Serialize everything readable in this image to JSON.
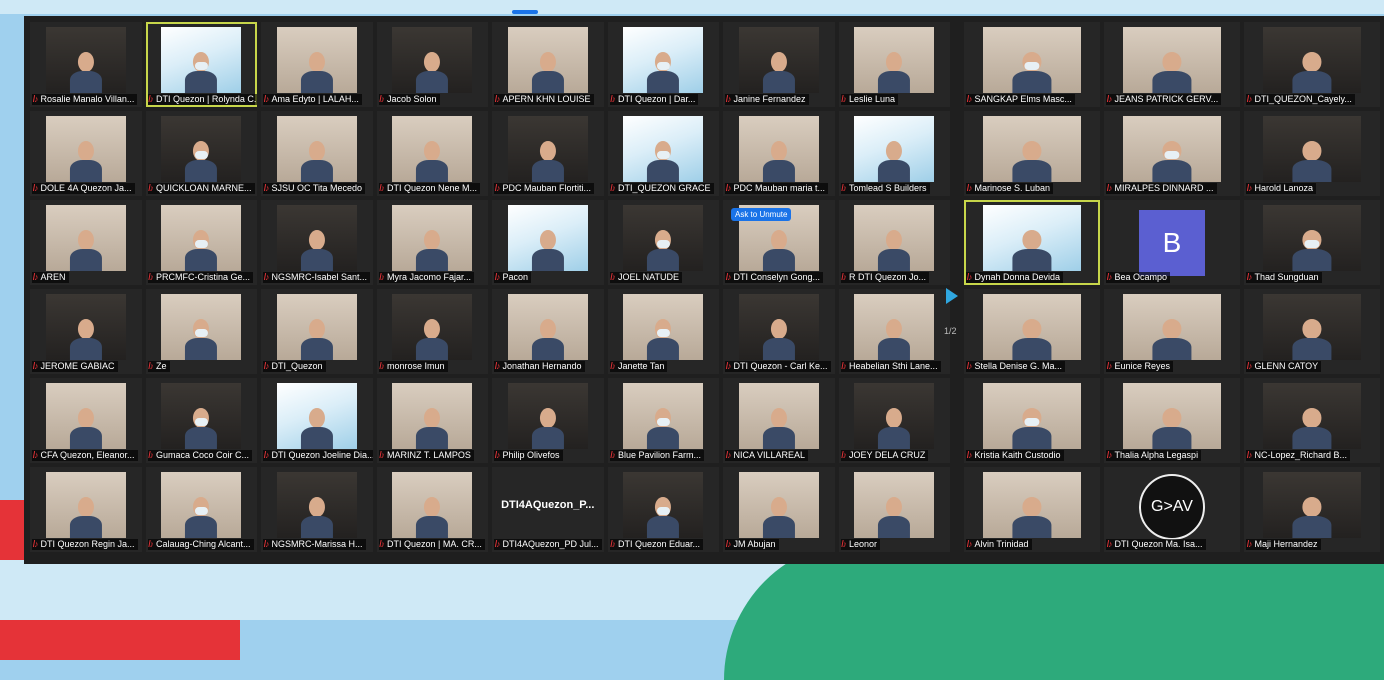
{
  "meeting": {
    "left_tiles": [
      {
        "name": "Rosalie Manalo Villan...",
        "kind": "photo"
      },
      {
        "name": "DTI Quezon | Rolynda C...",
        "kind": "slide",
        "active": true
      },
      {
        "name": "Ama Edyto | LALAH...",
        "kind": "photo"
      },
      {
        "name": "Jacob Solon",
        "kind": "photo"
      },
      {
        "name": "APERN KHN LOUISE",
        "kind": "photo"
      },
      {
        "name": "DTI Quezon | Dar...",
        "kind": "slide"
      },
      {
        "name": "Janine Fernandez",
        "kind": "photo"
      },
      {
        "name": "Leslie Luna",
        "kind": "photo"
      },
      {
        "name": "DOLE 4A Quezon Ja...",
        "kind": "photo"
      },
      {
        "name": "QUICKLOAN MARNE...",
        "kind": "photo"
      },
      {
        "name": "SJSU OC Tita Mecedo",
        "kind": "photo"
      },
      {
        "name": "DTI Quezon Nene M...",
        "kind": "photo"
      },
      {
        "name": "PDC Mauban Flortiti...",
        "kind": "photo"
      },
      {
        "name": "DTI_QUEZON GRACE",
        "kind": "slide"
      },
      {
        "name": "PDC Mauban maria t...",
        "kind": "photo"
      },
      {
        "name": "Tomlead S Builders",
        "kind": "slide"
      },
      {
        "name": "AREN",
        "kind": "photo"
      },
      {
        "name": "PRCMFC-Cristina Ge...",
        "kind": "photo"
      },
      {
        "name": "NGSMRC-Isabel Sant...",
        "kind": "photo"
      },
      {
        "name": "Myra Jacomo Fajar...",
        "kind": "photo"
      },
      {
        "name": "Pacon",
        "kind": "slide"
      },
      {
        "name": "JOEL NATUDE",
        "kind": "photo"
      },
      {
        "name": "DTI Conselyn Gong...",
        "kind": "photo",
        "pill": "Ask to Unmute"
      },
      {
        "name": "R DTI Quezon Jo...",
        "kind": "photo"
      },
      {
        "name": "JEROME GABIAC",
        "kind": "photo"
      },
      {
        "name": "Ze",
        "kind": "photo"
      },
      {
        "name": "DTI_Quezon",
        "kind": "photo"
      },
      {
        "name": "monrose Imun",
        "kind": "photo"
      },
      {
        "name": "Jonathan Hernando",
        "kind": "photo"
      },
      {
        "name": "Janette Tan",
        "kind": "photo"
      },
      {
        "name": "DTI Quezon - Carl Ke...",
        "kind": "photo"
      },
      {
        "name": "Heabelian Sthi Lane...",
        "kind": "photo"
      },
      {
        "name": "CFA Quezon, Eleanor...",
        "kind": "photo"
      },
      {
        "name": "Gumaca Coco Coir C...",
        "kind": "photo"
      },
      {
        "name": "DTI Quezon Joeline Dia...",
        "kind": "slide"
      },
      {
        "name": "MARINZ T. LAMPOS",
        "kind": "photo"
      },
      {
        "name": "Philip Olivefos",
        "kind": "photo"
      },
      {
        "name": "Blue Pavilion Farm...",
        "kind": "photo"
      },
      {
        "name": "NICA VILLAREAL",
        "kind": "photo"
      },
      {
        "name": "JOEY DELA CRUZ",
        "kind": "photo"
      },
      {
        "name": "DTI Quezon Regin Ja...",
        "kind": "photo"
      },
      {
        "name": "Calauag-Ching Alcant...",
        "kind": "photo"
      },
      {
        "name": "NGSMRC-Marissa H...",
        "kind": "photo"
      },
      {
        "name": "DTI Quezon | MA. CR...",
        "kind": "photo"
      },
      {
        "name": "DTI4AQuezon_PD Jul...",
        "kind": "label",
        "label": "DTI4AQuezon_P..."
      },
      {
        "name": "DTI Quezon Eduar...",
        "kind": "photo"
      },
      {
        "name": "JM Abujan",
        "kind": "photo"
      },
      {
        "name": "Leonor",
        "kind": "photo"
      }
    ],
    "right_tiles": [
      {
        "name": "SANGKAP Elms Masc...",
        "kind": "photo"
      },
      {
        "name": "JEANS PATRICK GERV...",
        "kind": "photo"
      },
      {
        "name": "DTI_QUEZON_Cayely...",
        "kind": "photo"
      },
      {
        "name": "Marinose S. Luban",
        "kind": "photo"
      },
      {
        "name": "MIRALPES DINNARD ...",
        "kind": "photo"
      },
      {
        "name": "Harold Lanoza",
        "kind": "photo"
      },
      {
        "name": "Dynah Donna Devida",
        "kind": "slide",
        "active": true
      },
      {
        "name": "Bea Ocampo",
        "kind": "avatar",
        "avatar": "B"
      },
      {
        "name": "Thad Sungduan",
        "kind": "photo"
      },
      {
        "name": "Stella Denise G. Ma...",
        "kind": "photo"
      },
      {
        "name": "Eunice Reyes",
        "kind": "photo"
      },
      {
        "name": "GLENN CATOY",
        "kind": "photo"
      },
      {
        "name": "Kristia Kaith Custodio",
        "kind": "photo"
      },
      {
        "name": "Thalia Alpha Legaspi",
        "kind": "photo"
      },
      {
        "name": "NC-Lopez_Richard B...",
        "kind": "photo"
      },
      {
        "name": "Alvin Trinidad",
        "kind": "photo"
      },
      {
        "name": "DTI Quezon Ma. Isa...",
        "kind": "logo",
        "logo": "G>AV"
      },
      {
        "name": "Maji Hernandez",
        "kind": "photo"
      }
    ],
    "page_indicator": "1/2"
  }
}
